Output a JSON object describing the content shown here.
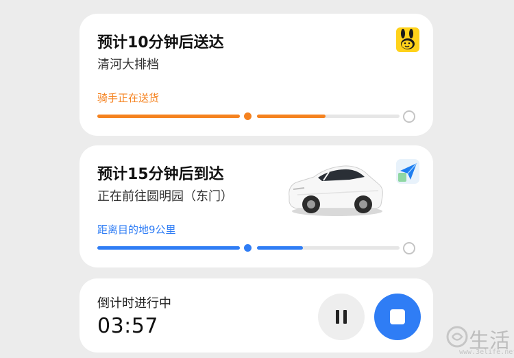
{
  "delivery_card": {
    "title": "预计10分钟后送达",
    "subtitle": "清河大排档",
    "status": "骑手正在送货",
    "accent_color": "#f5821f",
    "app_icon": "meituan-kangaroo-icon",
    "progress": {
      "segment_1": 1.0,
      "segment_2": 0.48
    }
  },
  "ride_card": {
    "title": "预计15分钟后到达",
    "subtitle": "正在前往圆明园（东门）",
    "status": "距离目的地9公里",
    "accent_color": "#2f7df5",
    "app_icon": "navigation-arrow-icon",
    "image": "white-car-image",
    "progress": {
      "segment_1": 1.0,
      "segment_2": 0.32
    }
  },
  "timer_card": {
    "label": "倒计时进行中",
    "time": "03:57",
    "pause_icon": "pause-icon",
    "stop_icon": "stop-icon",
    "stop_color": "#2f7df5"
  },
  "watermark": {
    "text": "生活",
    "url": "www.3elife.net"
  }
}
